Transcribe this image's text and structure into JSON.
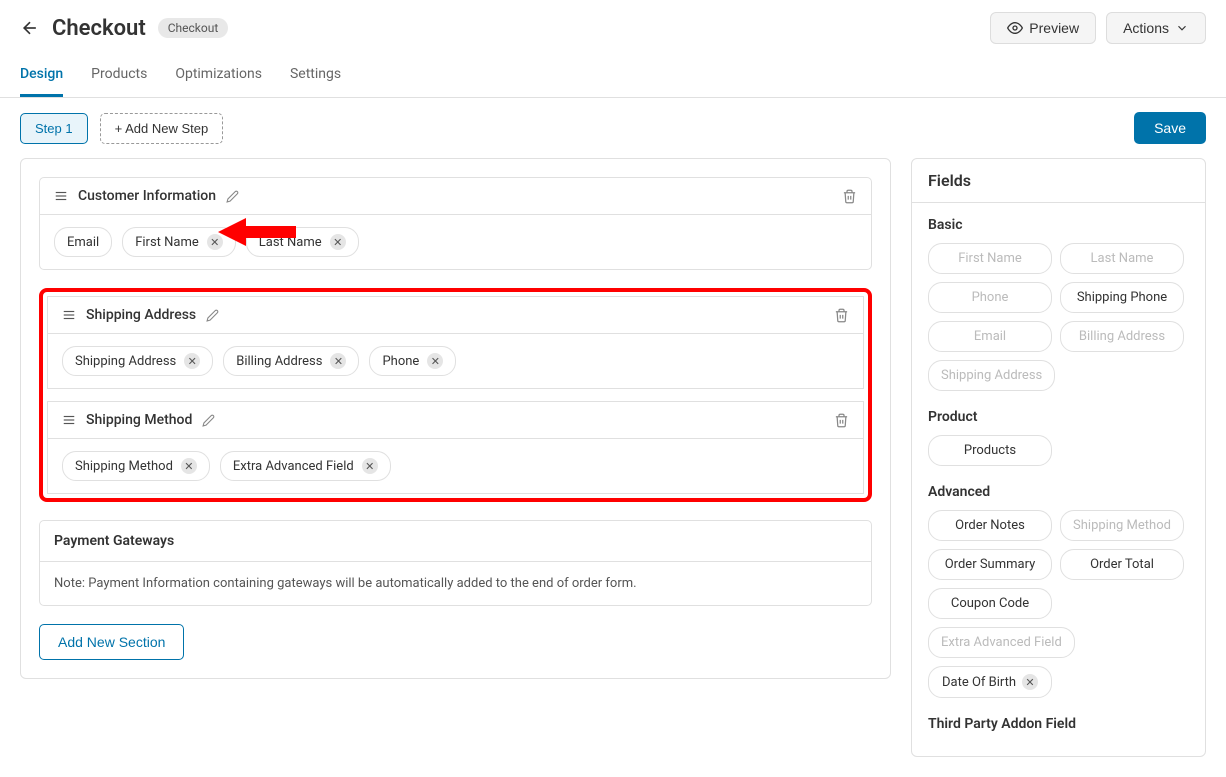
{
  "header": {
    "title": "Checkout",
    "badge": "Checkout",
    "preview": "Preview",
    "actions": "Actions"
  },
  "tabs": {
    "design": "Design",
    "products": "Products",
    "optimizations": "Optimizations",
    "settings": "Settings"
  },
  "toolbar": {
    "step1": "Step 1",
    "add_step": "+ Add New Step",
    "save": "Save"
  },
  "sections": {
    "customer_info": {
      "title": "Customer Information",
      "fields": {
        "email": "Email",
        "first_name": "First Name",
        "last_name": "Last Name"
      }
    },
    "shipping_address": {
      "title": "Shipping Address",
      "fields": {
        "shipping_address": "Shipping Address",
        "billing_address": "Billing Address",
        "phone": "Phone"
      }
    },
    "shipping_method": {
      "title": "Shipping Method",
      "fields": {
        "shipping_method": "Shipping Method",
        "extra_advanced": "Extra Advanced Field"
      }
    },
    "payment": {
      "title": "Payment Gateways",
      "note": "Note: Payment Information containing gateways will be automatically added to the end of order form."
    },
    "add_new": "Add New Section"
  },
  "sidebar": {
    "title": "Fields",
    "basic": {
      "heading": "Basic",
      "first_name": "First Name",
      "last_name": "Last Name",
      "phone": "Phone",
      "shipping_phone": "Shipping Phone",
      "email": "Email",
      "billing_address": "Billing Address",
      "shipping_address": "Shipping Address"
    },
    "product": {
      "heading": "Product",
      "products": "Products"
    },
    "advanced": {
      "heading": "Advanced",
      "order_notes": "Order Notes",
      "shipping_method": "Shipping Method",
      "order_summary": "Order Summary",
      "order_total": "Order Total",
      "coupon_code": "Coupon Code",
      "extra_advanced": "Extra Advanced Field",
      "dob": "Date Of Birth"
    },
    "third_party": {
      "heading": "Third Party Addon Field"
    }
  }
}
